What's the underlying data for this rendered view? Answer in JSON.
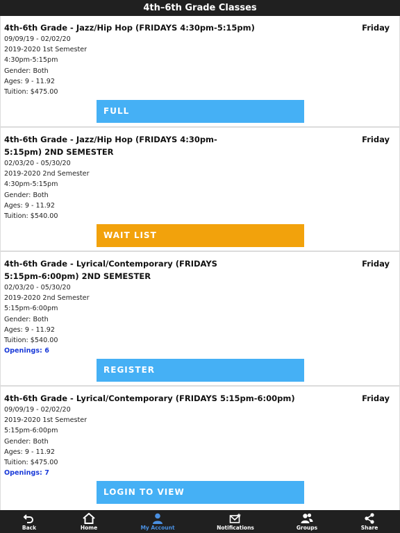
{
  "header": {
    "title": "4th–6th Grade Classes"
  },
  "classes": [
    {
      "title": "4th-6th Grade - Jazz/Hip Hop (FRIDAYS 4:30pm-5:15pm)",
      "day": "Friday",
      "dates": "09/09/19 - 02/02/20",
      "semester": "2019-2020 1st Semester",
      "time": "4:30pm-5:15pm",
      "gender": "Gender: Both",
      "ages": "Ages: 9 - 11.92",
      "tuition": "Tuition: $475.00",
      "openings": "",
      "button": {
        "label": "FULL",
        "color": "#45b0f5"
      }
    },
    {
      "title": "4th-6th Grade - Jazz/Hip Hop (FRIDAYS 4:30pm-5:15pm) 2ND SEMESTER",
      "day": "Friday",
      "dates": "02/03/20 - 05/30/20",
      "semester": "2019-2020 2nd Semester",
      "time": "4:30pm-5:15pm",
      "gender": "Gender: Both",
      "ages": "Ages: 9 - 11.92",
      "tuition": "Tuition: $540.00",
      "openings": "",
      "button": {
        "label": "WAIT LIST",
        "color": "#f2a20c"
      }
    },
    {
      "title": "4th-6th Grade - Lyrical/Contemporary (FRIDAYS 5:15pm-6:00pm) 2ND SEMESTER",
      "day": "Friday",
      "dates": "02/03/20 - 05/30/20",
      "semester": "2019-2020 2nd Semester",
      "time": "5:15pm-6:00pm",
      "gender": "Gender: Both",
      "ages": "Ages: 9 - 11.92",
      "tuition": "Tuition: $540.00",
      "openings": "Openings: 6",
      "button": {
        "label": "REGISTER",
        "color": "#45b0f5"
      }
    },
    {
      "title": "4th-6th Grade - Lyrical/Contemporary (FRIDAYS 5:15pm-6:00pm)",
      "day": "Friday",
      "dates": "09/09/19 - 02/02/20",
      "semester": "2019-2020 1st Semester",
      "time": "5:15pm-6:00pm",
      "gender": "Gender: Both",
      "ages": "Ages: 9 - 11.92",
      "tuition": "Tuition: $475.00",
      "openings": "Openings: 7",
      "button": {
        "label": "LOGIN TO VIEW",
        "color": "#45b0f5"
      }
    }
  ],
  "tabbar": {
    "items": [
      {
        "label": "Back",
        "icon": "back-arrow-icon"
      },
      {
        "label": "Home",
        "icon": "home-icon"
      },
      {
        "label": "My Account",
        "icon": "person-icon",
        "active": true
      },
      {
        "label": "Notifications",
        "icon": "envelope-icon"
      },
      {
        "label": "Groups",
        "icon": "groups-icon"
      },
      {
        "label": "Share",
        "icon": "share-icon"
      }
    ],
    "active_color": "#4a90e2"
  }
}
